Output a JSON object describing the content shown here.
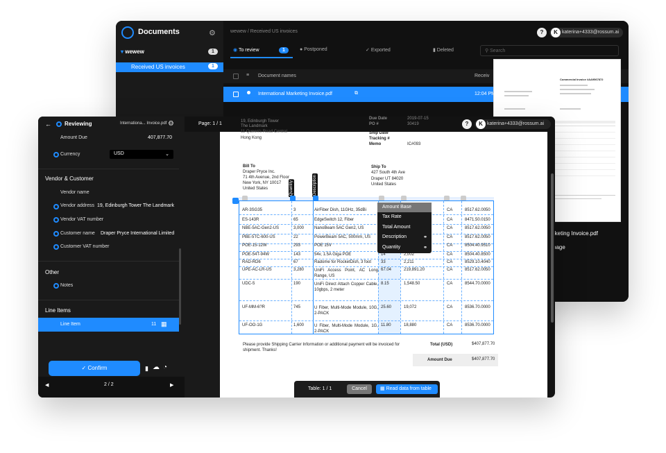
{
  "back_window": {
    "app_title": "Documents",
    "queue_name": "wewew",
    "queue_count": "1",
    "selected_queue": "Received US invoices",
    "selected_queue_count": "1",
    "breadcrumb": "wewew / Received US invoices",
    "help": "?",
    "account_initial": "K",
    "account": "katerina+4333@rossum.ai",
    "tabs": [
      {
        "label": "To review",
        "count": "1"
      },
      {
        "label": "Postponed"
      },
      {
        "label": "Exported"
      },
      {
        "label": "Deleted"
      }
    ],
    "search_placeholder": "Search",
    "column_header": "Document names",
    "column_received": "Receiv",
    "row_name": "International Marketing Invoice.pdf",
    "row_time": "12:04 PM",
    "preview_title": "Commercial Invoice #AA9567872",
    "preview_filename": "rketing Invoice.pdf",
    "preview_page": "page"
  },
  "front_window": {
    "header_title": "Reviewing",
    "header_file": "Internationa... Invoice.pdf",
    "page_indicator": "Page: 1 / 1",
    "help": "?",
    "account_initial": "K",
    "account": "katerina+4333@rossum.ai",
    "fields": {
      "amount_due_label": "Amount Due",
      "amount_due_value": "407,877.70",
      "currency_label": "Currency",
      "currency_value": "USD"
    },
    "section_vendor": "Vendor & Customer",
    "vendor_name_label": "Vendor name",
    "vendor_address_label": "Vendor address",
    "vendor_address_value": "19, Edinburgh Tower The Landmark",
    "vendor_vat_label": "Vendor VAT number",
    "customer_name_label": "Customer name",
    "customer_name_value": "Draper Pryce International Limited",
    "customer_vat_label": "Customer VAT number",
    "section_other": "Other",
    "notes_label": "Notes",
    "section_line_items": "Line Items",
    "line_item_label": "Line Item",
    "line_item_count": "11",
    "confirm_label": "Confirm",
    "pager": "2 / 2",
    "table_indicator": "Table: 1 / 1",
    "cancel_label": "Cancel",
    "read_table_label": "Read data from table"
  },
  "document": {
    "address_lines": [
      "19, Edinburgh Tower",
      "The Landmark",
      "11 Queen's Road Central",
      "Hong Kong"
    ],
    "meta_labels": [
      "Due Date",
      "PO #",
      "Ship Date",
      "Tracking #",
      "Memo"
    ],
    "meta_values": [
      "2019-07-15",
      "30419",
      "",
      "",
      "IC#093"
    ],
    "bill_to_title": "Bill To",
    "bill_to_lines": [
      "Draper Pryce Inc.",
      "71 4th Avenue, 2nd Floor",
      "New York, NY 10017",
      "United States"
    ],
    "ship_to_title": "Ship To",
    "ship_to_lines": [
      "427 South 4th Ave",
      "Draper UT 84020",
      "United States"
    ],
    "col_labels": [
      "Quantity",
      "Description"
    ],
    "rows": [
      [
        "AR-3SG35",
        "3",
        "AirFiber Dish, 11GHz, 35dBi",
        "",
        "",
        "CA",
        "8517.62.0050"
      ],
      [
        "ES-143R",
        "65",
        "EdgeSwitch 12, Fiber",
        "",
        "",
        "CA",
        "8471.50.0150"
      ],
      [
        "NBE-5AC-Gen2-US",
        "3,000",
        "NanoBeam 5AC Gen2, US",
        "",
        "",
        "CA",
        "8517.62.0050"
      ],
      [
        "PBE-5TC-600-US",
        "22",
        "PowerBeam 5AC, 500mm, US",
        "",
        "",
        "CA",
        "8517.62.0050"
      ],
      [
        "POE-15-12W",
        "293",
        "POE 15V",
        "",
        "",
        "CA",
        "8504.40.9510"
      ],
      [
        "POE-54T-94W",
        "143",
        "54v, 1.5A Giga POE",
        "14",
        "2,002",
        "CA",
        "8504.40.8500"
      ],
      [
        "RAD-RD6",
        "67",
        "Radome for RocketDish, 3 foot",
        "33",
        "2,211",
        "CA",
        "8529.10.4040"
      ],
      [
        "UPE-AC-LR-US",
        "3,280",
        "UniFi Access Point, AC Long Range, US",
        "67.04",
        "219,891.20",
        "CA",
        "8517.62.0050"
      ],
      [
        "UDC-5",
        "190",
        "UniFi Direct Attach Copper Cable, 10gbps, 2 meter",
        "8.15",
        "1,548.50",
        "CA",
        "8544.70.0000"
      ],
      [
        "UF-MM-6?R",
        "745",
        "U Fiber, Multi-Mode Module, 10G, 2-PACK",
        "25.60",
        "19,072",
        "CA",
        "8536.70.0000"
      ],
      [
        "UF-OO-1G",
        "1,600",
        "U Fiber, Multi-Mode Module, 1G, 2-PACK",
        "11.80",
        "18,880",
        "CA",
        "8536.70.0000"
      ]
    ],
    "menu_items": [
      "Amount Base",
      "Tax Rate",
      "Total Amount",
      "Description",
      "Quantity"
    ],
    "footer_note_1": "Please provide Shipping Carrier Information or additional payment will be invoiced for",
    "footer_note_2": "shipment. Thanks!",
    "total_label": "Total (USD)",
    "total_value": "$407,877.70",
    "amount_due_label": "Amount Due",
    "amount_due_value": "$407,877.70"
  }
}
